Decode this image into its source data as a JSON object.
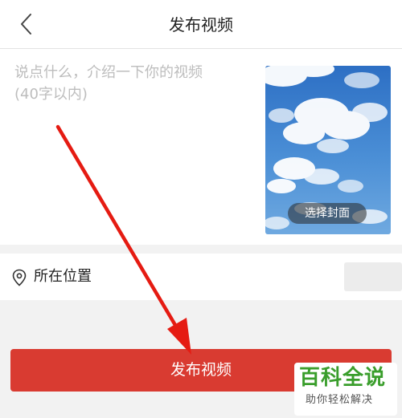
{
  "nav": {
    "title": "发布视频",
    "back_icon": "chevron-left-icon"
  },
  "compose": {
    "placeholder": "说点什么，介绍一下你的视频\n(40字以内)",
    "value": "",
    "cover": {
      "button_label": "选择封面",
      "image": "sky-clouds-thumbnail"
    }
  },
  "location": {
    "icon": "location-pin-icon",
    "label": "所在位置",
    "value": ""
  },
  "publish": {
    "label": "发布视频",
    "color": "#d93b31"
  },
  "annotation": {
    "arrow_color": "#e51b12"
  },
  "watermark": {
    "main": "百科全说",
    "sub": "助你轻松解决"
  }
}
